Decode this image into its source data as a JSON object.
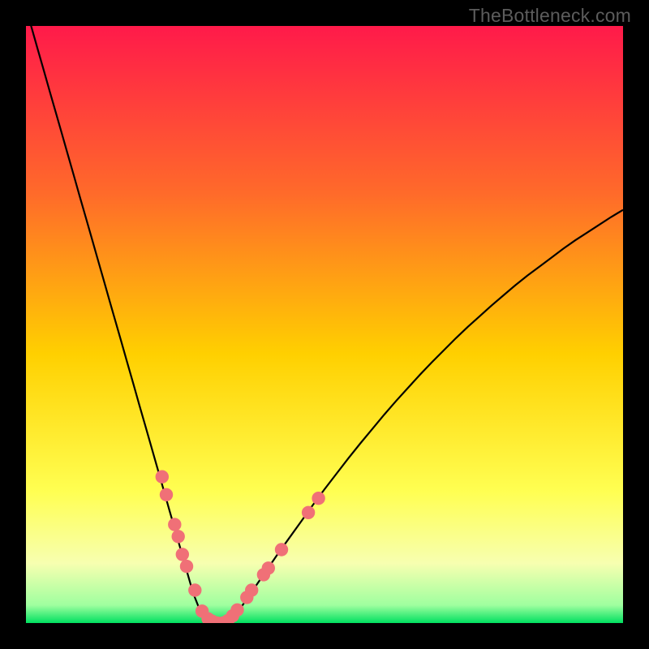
{
  "watermark": "TheBottleneck.com",
  "colors": {
    "frame": "#000000",
    "grad_top": "#ff1a4a",
    "grad_mid1": "#ff6a2a",
    "grad_mid2": "#ffd000",
    "grad_mid3": "#ffff52",
    "grad_low": "#f7ffb0",
    "grad_green": "#00e060",
    "curve": "#000000",
    "dot_fill": "#f07077",
    "dot_stroke": "#cc4a56"
  },
  "chart_data": {
    "type": "line",
    "title": "",
    "xlabel": "",
    "ylabel": "",
    "xlim": [
      0,
      100
    ],
    "ylim": [
      0,
      100
    ],
    "series": [
      {
        "name": "bottleneck-curve",
        "x": [
          0,
          1,
          2,
          3,
          4,
          5,
          6,
          7,
          8,
          9,
          10,
          11,
          12,
          13,
          14,
          15,
          16,
          17,
          18,
          19,
          20,
          21,
          22,
          23,
          24,
          25,
          26,
          27,
          28,
          29,
          30,
          31,
          32,
          33,
          34,
          35,
          36,
          38,
          40,
          42,
          44,
          46,
          48,
          50,
          52,
          54,
          56,
          58,
          60,
          62,
          64,
          66,
          68,
          70,
          72,
          74,
          76,
          78,
          80,
          82,
          84,
          86,
          88,
          90,
          92,
          94,
          96,
          98,
          100
        ],
        "y": [
          103,
          99.5,
          96,
          92.5,
          89,
          85.5,
          82,
          78.5,
          75,
          71.5,
          68,
          64.5,
          61,
          57.5,
          54,
          50.5,
          47,
          43.5,
          40,
          36.5,
          33,
          29.5,
          26,
          22.5,
          19,
          15.5,
          12,
          8.5,
          5,
          2.5,
          0.8,
          0.2,
          0,
          0,
          0.3,
          1.2,
          2.6,
          5.5,
          8.4,
          11.3,
          14.1,
          16.9,
          19.7,
          22.4,
          25.0,
          27.6,
          30.1,
          32.5,
          34.9,
          37.2,
          39.4,
          41.6,
          43.7,
          45.7,
          47.7,
          49.6,
          51.4,
          53.2,
          54.9,
          56.6,
          58.2,
          59.7,
          61.2,
          62.7,
          64.1,
          65.4,
          66.7,
          68.0,
          69.2
        ]
      }
    ],
    "dots": [
      {
        "x": 22.8,
        "y": 24.5
      },
      {
        "x": 23.5,
        "y": 21.5
      },
      {
        "x": 24.9,
        "y": 16.5
      },
      {
        "x": 25.5,
        "y": 14.5
      },
      {
        "x": 26.2,
        "y": 11.5
      },
      {
        "x": 26.9,
        "y": 9.5
      },
      {
        "x": 28.3,
        "y": 5.5
      },
      {
        "x": 29.5,
        "y": 2.0
      },
      {
        "x": 30.5,
        "y": 0.7
      },
      {
        "x": 31.2,
        "y": 0.3
      },
      {
        "x": 32.0,
        "y": 0.0
      },
      {
        "x": 33.0,
        "y": 0.0
      },
      {
        "x": 33.8,
        "y": 0.4
      },
      {
        "x": 34.6,
        "y": 1.2
      },
      {
        "x": 35.4,
        "y": 2.2
      },
      {
        "x": 37.0,
        "y": 4.3
      },
      {
        "x": 37.8,
        "y": 5.5
      },
      {
        "x": 39.8,
        "y": 8.1
      },
      {
        "x": 40.6,
        "y": 9.2
      },
      {
        "x": 42.8,
        "y": 12.3
      },
      {
        "x": 47.3,
        "y": 18.5
      },
      {
        "x": 49.0,
        "y": 20.9
      }
    ]
  }
}
